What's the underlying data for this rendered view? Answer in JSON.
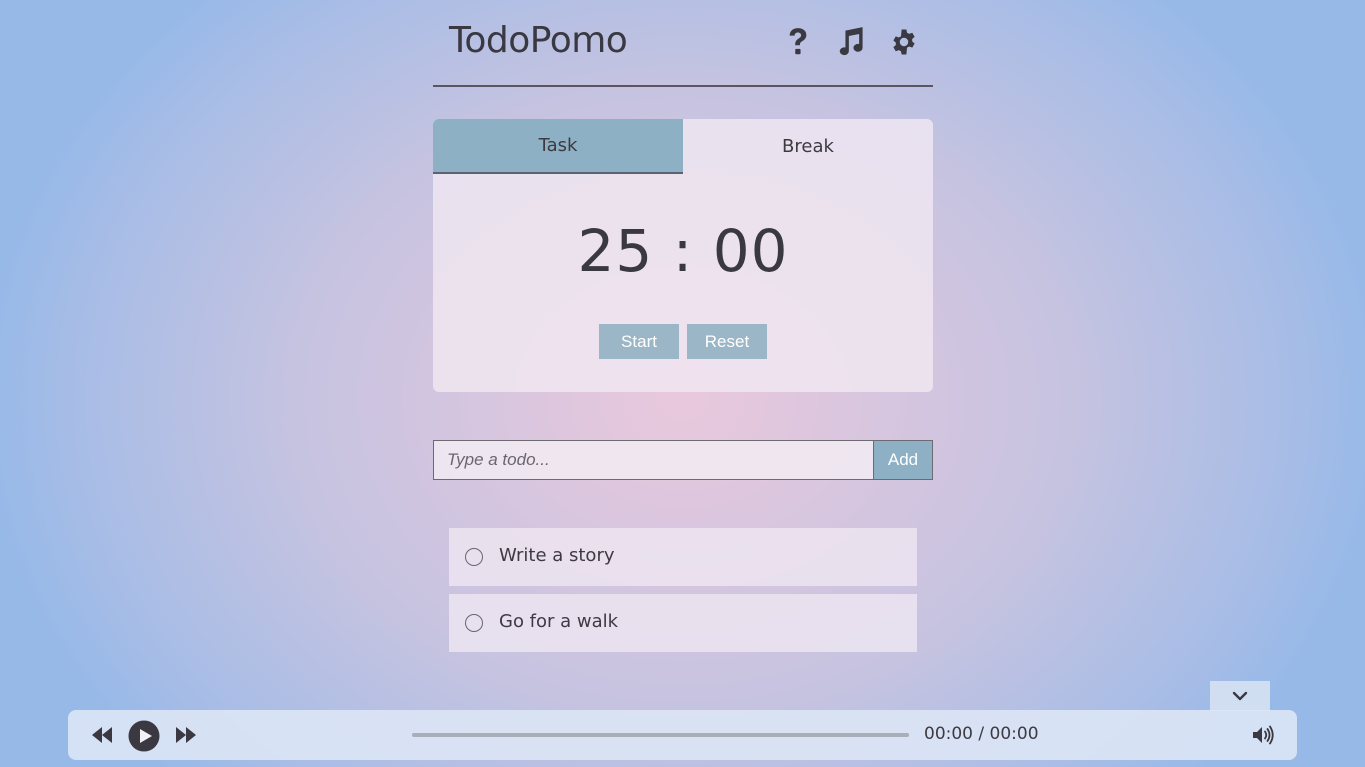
{
  "app": {
    "title": "TodoPomo"
  },
  "header": {
    "icons": [
      "help-icon",
      "music-icon",
      "settings-icon"
    ]
  },
  "timer": {
    "tabs": [
      {
        "label": "Task",
        "active": true
      },
      {
        "label": "Break",
        "active": false
      }
    ],
    "display": "25 : 00",
    "start_label": "Start",
    "reset_label": "Reset"
  },
  "todo_form": {
    "placeholder": "Type a todo...",
    "value": "",
    "add_label": "Add"
  },
  "todos": [
    {
      "text": "Write a story",
      "done": false
    },
    {
      "text": "Go for a walk",
      "done": false
    }
  ],
  "player": {
    "time_display": "00:00 / 00:00",
    "progress": 0,
    "playing": false
  },
  "colors": {
    "accent": "#8eb0c4",
    "button": "#9bb6c6",
    "text": "#3d3a42"
  }
}
